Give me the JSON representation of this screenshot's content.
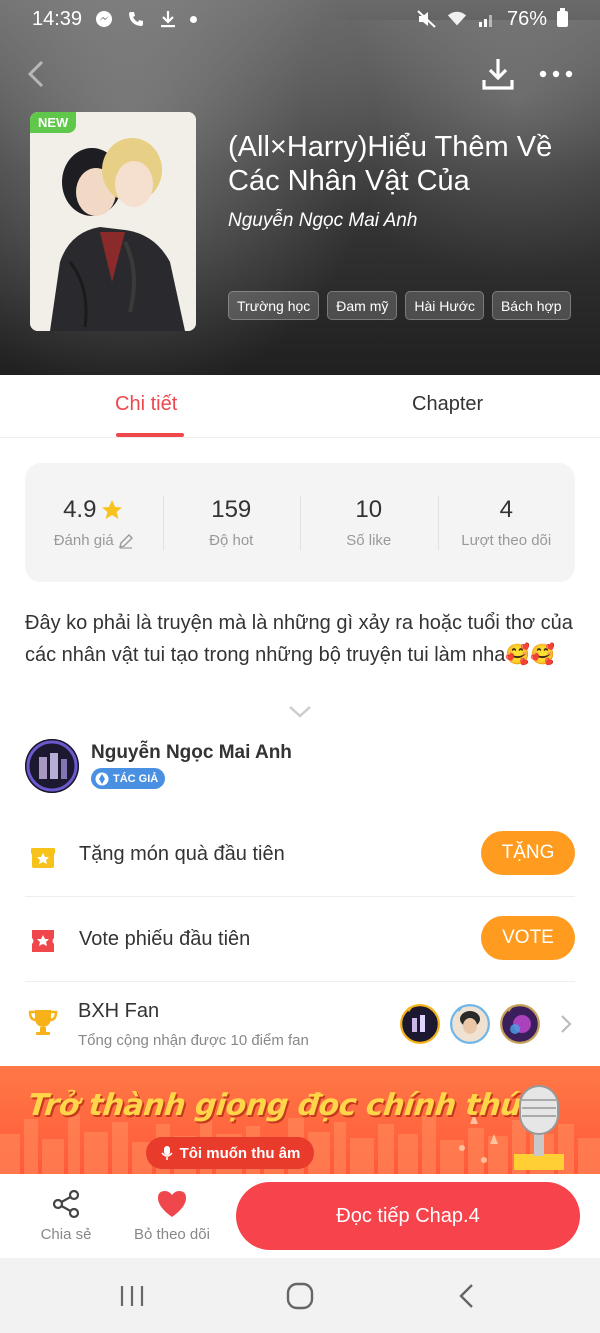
{
  "status_bar": {
    "time": "14:39",
    "battery": "76%",
    "icons": [
      "messenger-icon",
      "phone-icon",
      "download-icon",
      "dot-icon",
      "mute-icon",
      "wifi-icon",
      "signal-icon",
      "battery-icon"
    ]
  },
  "header": {
    "back_icon": "back-arrow-icon",
    "download_icon": "download-icon",
    "more_icon": "more-dots-icon"
  },
  "book": {
    "badge": "NEW",
    "title": "(All×Harry)Hiểu Thêm Về Các Nhân Vật Của",
    "author": "Nguyễn Ngọc Mai Anh",
    "tags": [
      "Trường học",
      "Đam mỹ",
      "Hài Hước",
      "Bách hợp"
    ]
  },
  "tabs": [
    {
      "label": "Chi tiết",
      "active": true
    },
    {
      "label": "Chapter",
      "active": false
    }
  ],
  "stats": [
    {
      "value": "4.9",
      "label": "Đánh giá",
      "icon": "star-icon"
    },
    {
      "value": "159",
      "label": "Độ hot"
    },
    {
      "value": "10",
      "label": "Số like"
    },
    {
      "value": "4",
      "label": "Lượt theo dõi"
    }
  ],
  "description": "Đây ko phải là truyện mà là những gì xảy ra hoặc tuổi thơ của các nhân vật tui tạo trong những bộ truyện tui làm nha🥰🥰",
  "author_section": {
    "name": "Nguyễn Ngọc Mai Anh",
    "badge": "TÁC GIẢ"
  },
  "actions": {
    "gift": {
      "label": "Tặng món quà đầu tiên",
      "button": "TẶNG"
    },
    "vote": {
      "label": "Vote phiếu đầu tiên",
      "button": "VOTE"
    }
  },
  "fan_ranking": {
    "title": "BXH Fan",
    "subtitle": "Tổng cộng nhận được 10 điểm fan"
  },
  "banner": {
    "title": "Trở thành giọng đọc chính thức!",
    "button": "Tôi muốn thu âm"
  },
  "bottom_bar": {
    "share_label": "Chia sẻ",
    "unfollow_label": "Bỏ theo dõi",
    "read_button": "Đọc tiếp Chap.4"
  },
  "colors": {
    "accent": "#f0474d",
    "orange": "#ff9b1f",
    "read_button": "#f7434b",
    "banner": "#ff6a40"
  }
}
